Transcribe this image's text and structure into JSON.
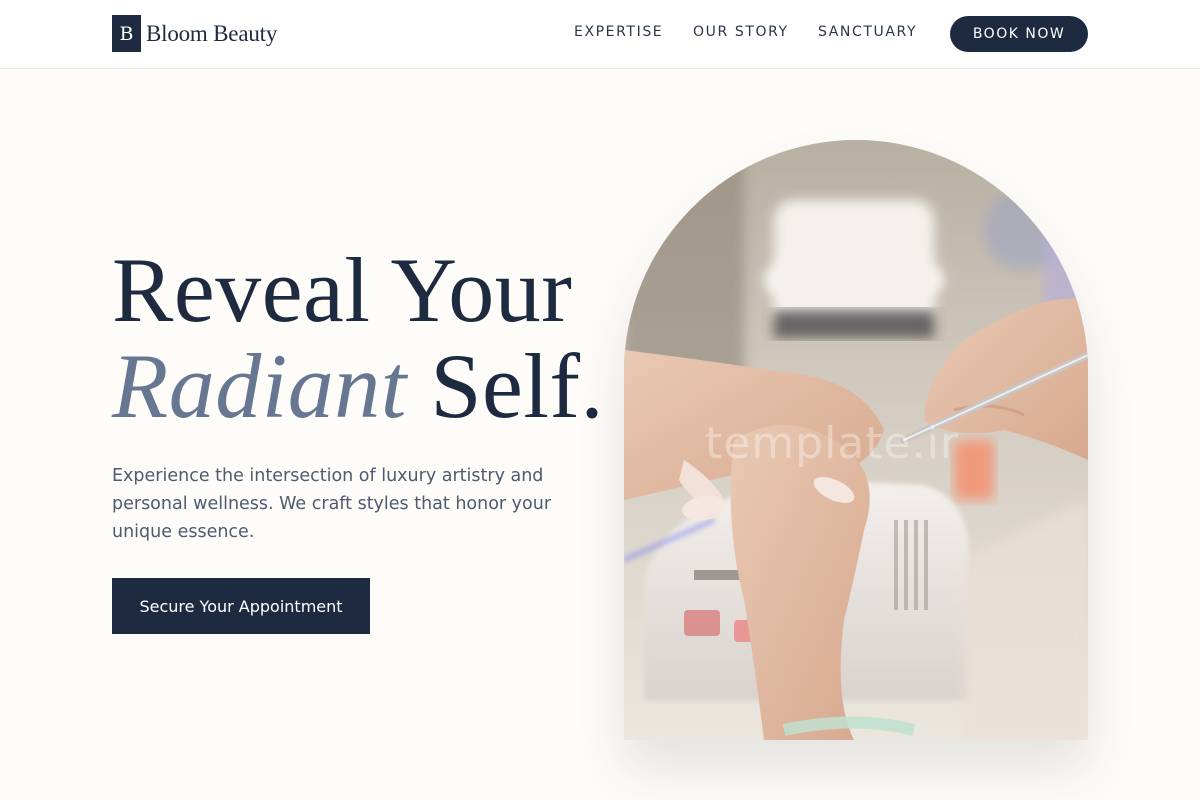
{
  "brand": {
    "mark": "B",
    "name": "Bloom Beauty"
  },
  "nav": {
    "items": [
      "EXPERTISE",
      "OUR STORY",
      "SANCTUARY"
    ],
    "book_label": "BOOK NOW"
  },
  "hero": {
    "headline_line1": "Reveal Your",
    "headline_italic": "Radiant",
    "headline_rest": " Self.",
    "subtext": "Experience the intersection of luxury artistry and personal wellness. We craft styles that honor your unique essence.",
    "cta_label": "Secure Your Appointment",
    "image_alt": "Manicurist shaping nails at a salon table",
    "watermark": "template.ir"
  },
  "colors": {
    "navy": "#1e2a40",
    "slate_accent": "#677791",
    "cream_bg": "#fdfcf9"
  }
}
